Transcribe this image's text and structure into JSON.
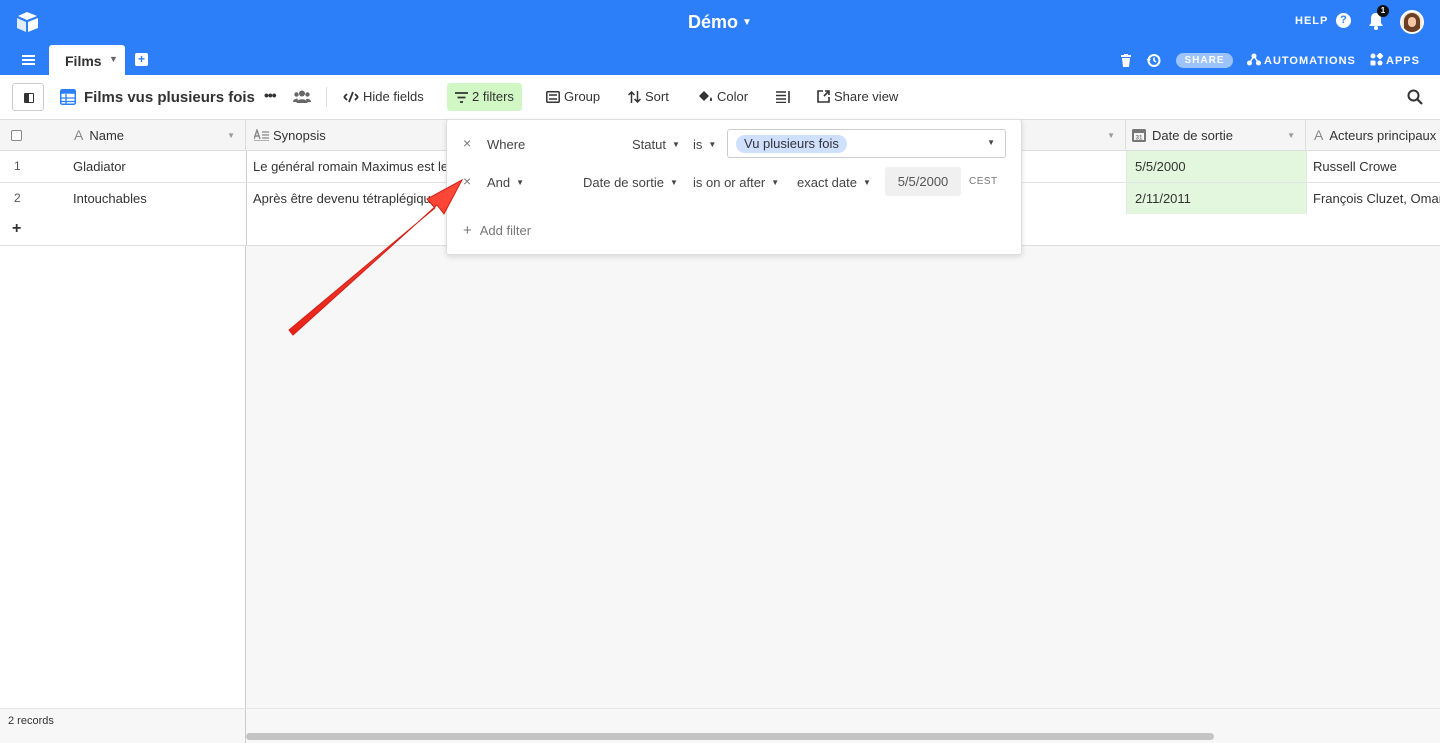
{
  "header": {
    "base_title": "Démo",
    "help_label": "HELP",
    "help_icon": "?",
    "notification_count": "1"
  },
  "tabs": {
    "active_table": "Films",
    "share_label": "SHARE",
    "automations_label": "AUTOMATIONS",
    "apps_label": "APPS"
  },
  "toolbar": {
    "view_name": "Films vus plusieurs fois",
    "more_label": "•••",
    "hide_fields": "Hide fields",
    "filters": "2 filters",
    "group": "Group",
    "sort": "Sort",
    "color": "Color",
    "share_view": "Share view"
  },
  "columns": {
    "name": "Name",
    "synopsis": "Synopsis",
    "date": "Date de sortie",
    "actors": "Acteurs principaux"
  },
  "rows": [
    {
      "num": "1",
      "name": "Gladiator",
      "synopsis": "Le général romain Maximus est le plus fidèle",
      "date": "5/5/2000",
      "actors": "Russell Crowe"
    },
    {
      "num": "2",
      "name": "Intouchables",
      "synopsis": "Après être devenu tétraplégique à la suite",
      "date": "2/11/2011",
      "actors": "François Cluzet, Omar Sy"
    }
  ],
  "add_row_label": "+",
  "footer": {
    "records": "2 records"
  },
  "filter_popover": {
    "rows": [
      {
        "conjunction": "Where",
        "field": "Statut",
        "operator": "is",
        "value": "Vu plusieurs fois"
      },
      {
        "conjunction": "And",
        "field": "Date de sortie",
        "operator": "is on or after",
        "mode": "exact date",
        "value": "5/5/2000",
        "timezone": "CEST"
      }
    ],
    "remove_icon": "×",
    "add_filter": "Add filter"
  },
  "colors": {
    "brand_blue": "#2d7ff9",
    "filter_active": "#d1f7c4",
    "date_cell": "#e3f6de",
    "pill": "#cfdfff",
    "arrow": "#f0352a"
  }
}
